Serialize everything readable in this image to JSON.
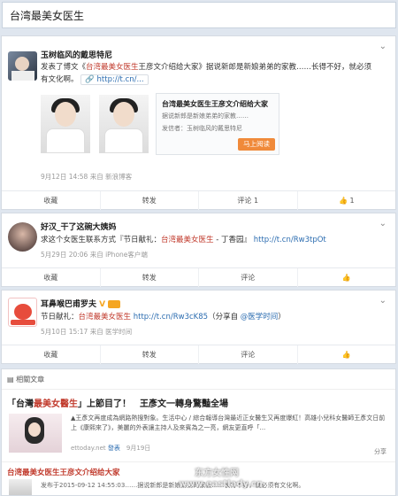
{
  "search": {
    "value": "台湾最美女医生"
  },
  "posts": [
    {
      "user": "玉树临风的戴思特尼",
      "text_a": "发表了博文《",
      "text_hl": "台湾最美女医生",
      "text_b": "王彦文介绍给大家》据说新郎是新娘弟弟的家教……长得不好，就必须有文化啊。",
      "link_chip": "http://t.cn/...",
      "article_title": "台湾最美女医生王彦文介绍给大家",
      "article_desc": "据说新郎是新娘弟弟的家教……",
      "article_author": "发信者：玉树临风的戴思特尼",
      "read_btn": "马上阅读",
      "meta": "9月12日 14:58 来自 新浪博客",
      "actions": {
        "fav": "收藏",
        "repost": "转发",
        "comment": "评论 1",
        "like": "1"
      }
    },
    {
      "user": "好汉_干了这碗大姨妈",
      "text_a": "求这个女医生联系方式『节日献礼：",
      "text_hl": "台湾最美女医生",
      "text_b": " - 丁香园』",
      "text_link": "http://t.cn/Rw3tpOt",
      "meta": "5月29日 20:06 来自 iPhone客户端",
      "actions": {
        "fav": "收藏",
        "repost": "转发",
        "comment": "评论",
        "like": ""
      }
    },
    {
      "user": "耳鼻喉巴甫罗夫",
      "vip": "V",
      "text_a": "节日献礼：",
      "text_hl": "台湾最美女医生",
      "text_link": " http://t.cn/Rw3cK85",
      "text_b": "（分享自 ",
      "text_link2": "@医学时间",
      "text_c": "）",
      "meta": "5月10日 15:17 来自 医学时间",
      "actions": {
        "fav": "收藏",
        "repost": "转发",
        "comment": "评论",
        "like": ""
      }
    }
  ],
  "related": {
    "header": "相關文章",
    "item1": {
      "title_a": "「台灣",
      "title_hl": "最美女醫生",
      "title_b": "」上節目了！　王彥文一轉身驚豔全場",
      "body": "▲王彥文再度成為網路熱搜對象。生活中心 / 綜合報導台灣最近正女醫生又再度爆紅！高雄小兒科女醫師王彥文日前上《康熙來了》，美麗的外表讓主持人及來賓為之一亮，網友更直呼「...",
      "source": "ettoday.net",
      "source_link": "發表",
      "date": "9月19日",
      "share": "分享"
    },
    "item2": {
      "title": "台湾最美女医生王彦文介绍给大家",
      "body": "发布于2015-09-12 14:55:03……据说新郎是新娘弟弟的家教……长得不好，就必须有文化啊。"
    }
  },
  "watermark": {
    "line1": "东方女性网",
    "line2": "www.eastlady.cn"
  },
  "colors": {
    "highlight": "#c0392b",
    "link": "#2b6cb0",
    "button": "#f08a3a"
  }
}
